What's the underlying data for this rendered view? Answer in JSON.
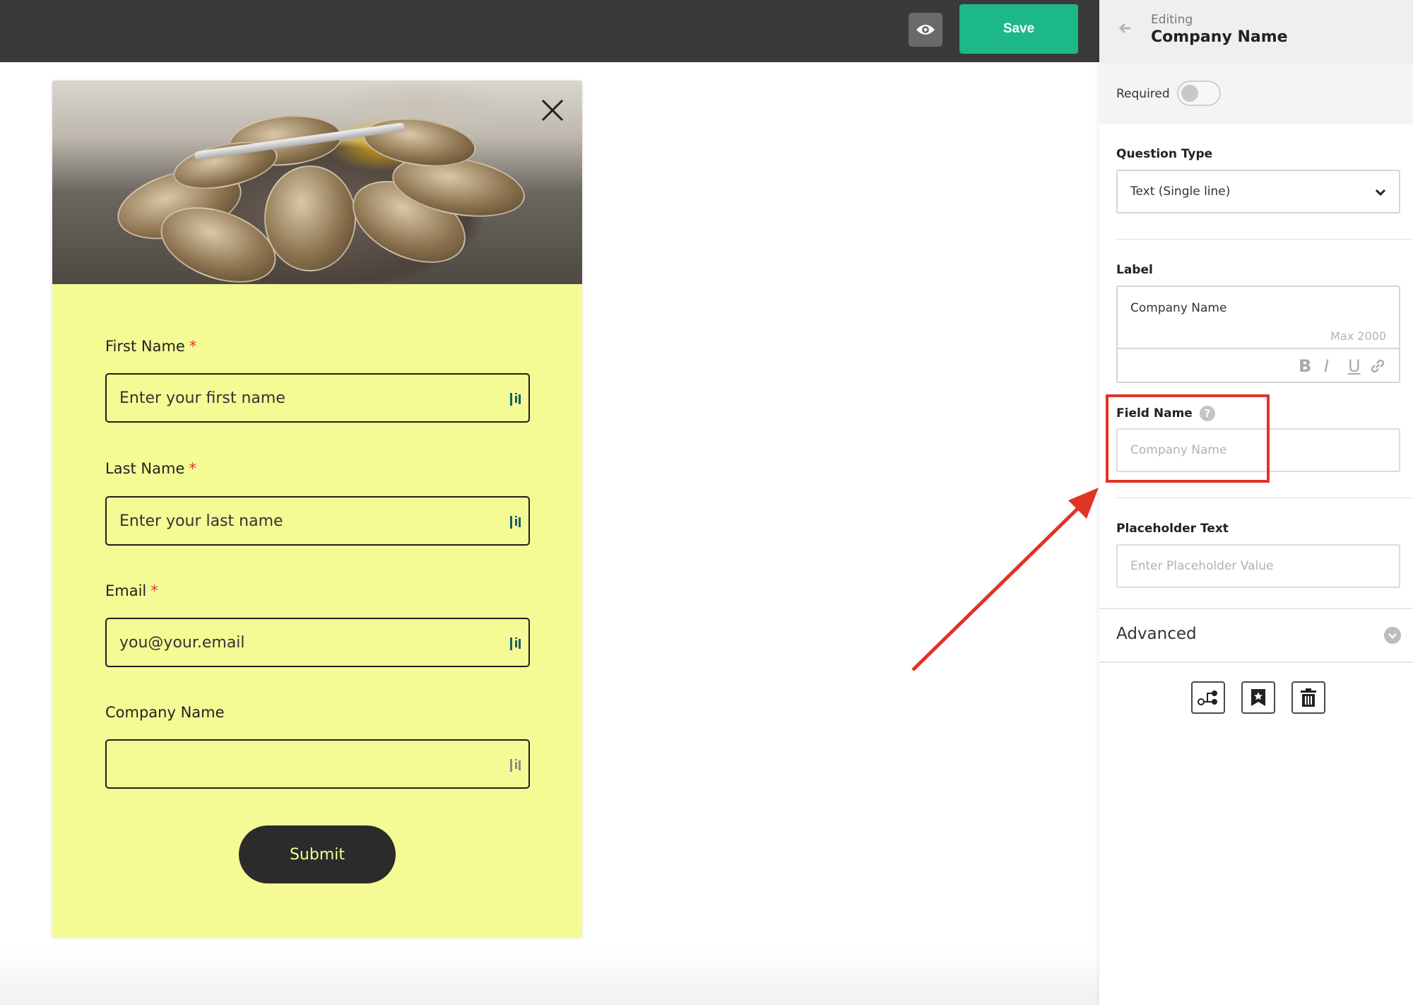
{
  "toolbar": {
    "preview_icon": "eye-icon",
    "save_label": "Save",
    "save_color": "#1db88a"
  },
  "form": {
    "background_color": "#f4fa94",
    "image_alt": "oysters-photo",
    "close_icon": "close-icon",
    "fields": [
      {
        "label": "First Name",
        "required_mark": "*",
        "placeholder": "Enter your first name"
      },
      {
        "label": "Last Name",
        "required_mark": "*",
        "placeholder": "Enter your last name"
      },
      {
        "label": "Email",
        "required_mark": "*",
        "placeholder": "you@your.email"
      },
      {
        "label": "Company Name",
        "required_mark": "",
        "placeholder": ""
      }
    ],
    "submit_label": "Submit"
  },
  "panel": {
    "editing_label": "Editing",
    "editing_title": "Company Name",
    "required_label": "Required",
    "required_on": false,
    "question_type_label": "Question Type",
    "question_type_value": "Text (Single line)",
    "label_heading": "Label",
    "label_value": "Company Name",
    "label_max": "Max 2000",
    "format_buttons": [
      "B",
      "I",
      "U"
    ],
    "field_name_heading": "Field Name",
    "field_name_placeholder": "Company Name",
    "placeholder_heading": "Placeholder Text",
    "placeholder_value_placeholder": "Enter Placeholder Value",
    "advanced_label": "Advanced",
    "action_icons": [
      "logic-icon",
      "bookmark-star-icon",
      "trash-icon"
    ]
  },
  "annotation": {
    "highlight_color": "#e03427"
  }
}
